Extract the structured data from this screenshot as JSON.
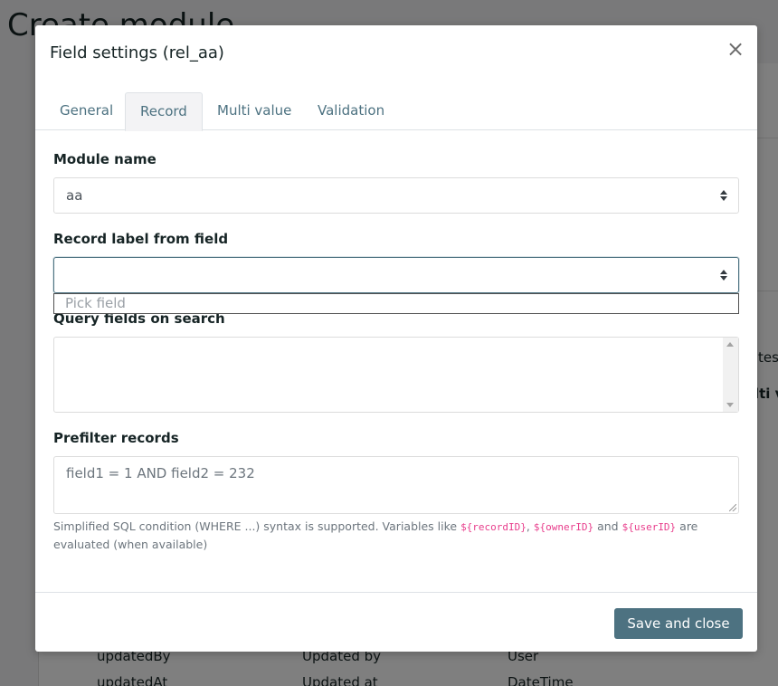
{
  "background": {
    "page_title": "Create module",
    "fragments": {
      "right_1": "tes",
      "right_2": "lti v"
    },
    "rows": [
      [
        "updatedBy",
        "Updated by",
        "User"
      ],
      [
        "updatedAt",
        "Updated at",
        "DateTime"
      ]
    ]
  },
  "modal": {
    "title": "Field settings (rel_aa)",
    "close_glyph": "×",
    "tabs": [
      {
        "label": "General",
        "active": false
      },
      {
        "label": "Record",
        "active": true
      },
      {
        "label": "Multi value",
        "active": false
      },
      {
        "label": "Validation",
        "active": false
      }
    ],
    "module_name": {
      "label": "Module name",
      "value": "aa"
    },
    "record_label": {
      "label": "Record label from field",
      "value": "",
      "dropdown_option": "Pick field"
    },
    "query_fields": {
      "label": "Query fields on search"
    },
    "prefilter": {
      "label": "Prefilter records",
      "placeholder": "field1 = 1 AND field2 = 232",
      "help_prefix": "Simplified SQL condition (WHERE ...) syntax is supported. Variables like ",
      "var_record": "${recordID}",
      "sep": ", ",
      "var_owner": "${ownerID}",
      "and": " and ",
      "var_user": "${userID}",
      "help_suffix": " are evaluated (when available)"
    },
    "save_label": "Save and close"
  },
  "colors": {
    "primary": "#4d7281",
    "code": "#e83e8c"
  }
}
